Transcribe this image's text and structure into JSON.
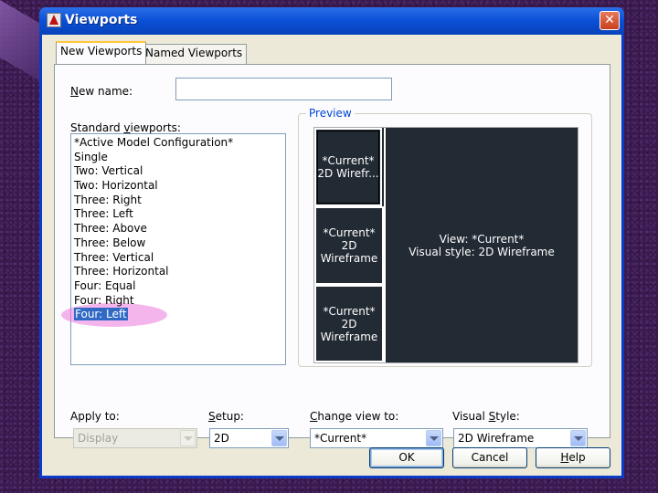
{
  "dialog": {
    "title": "Viewports",
    "close_glyph": "✕"
  },
  "tabs": [
    {
      "label": "New Viewports",
      "active": true
    },
    {
      "label": "Named Viewports",
      "active": false
    }
  ],
  "new_name": {
    "label": "New name:",
    "value": ""
  },
  "standard_viewports": {
    "label_before": "Standard ",
    "label_hotkey": "v",
    "label_after": "iewports:",
    "items": [
      "*Active Model Configuration*",
      "Single",
      "Two:  Vertical",
      "Two:  Horizontal",
      "Three: Right",
      "Three: Left",
      "Three: Above",
      "Three: Below",
      "Three: Vertical",
      "Three: Horizontal",
      "Four:  Equal",
      "Four:  Right",
      "Four:  Left"
    ],
    "selected_index": 12
  },
  "preview": {
    "label": "Preview",
    "top_left": {
      "line1": "*Current*",
      "line2": "2D Wirefr..."
    },
    "middle_left": {
      "line1": "*Current*",
      "line2": "2D Wireframe"
    },
    "bottom_left": {
      "line1": "*Current*",
      "line2": "2D Wireframe"
    },
    "right": {
      "line1": "View: *Current*",
      "line2": "Visual style: 2D Wireframe"
    }
  },
  "controls": {
    "apply_to": {
      "label": "Apply to:",
      "value": "Display",
      "disabled": true
    },
    "setup": {
      "label_hotkey": "S",
      "label_rest": "etup:",
      "value": "2D"
    },
    "change_view_to": {
      "label_before": "",
      "label_hotkey": "C",
      "label_after": "hange view to:",
      "value": "*Current*"
    },
    "visual_style": {
      "label_before": "Visual ",
      "label_hotkey": "S",
      "label_after": "tyle:",
      "value": "2D Wireframe"
    }
  },
  "buttons": {
    "ok": "OK",
    "cancel": "Cancel",
    "help_hotkey": "H",
    "help_rest": "elp"
  },
  "colors": {
    "titlebar": "#0a4fd6",
    "preview_bg": "#222a33",
    "selection": "#316ac5",
    "highlight_oval": "#eb78dc"
  }
}
